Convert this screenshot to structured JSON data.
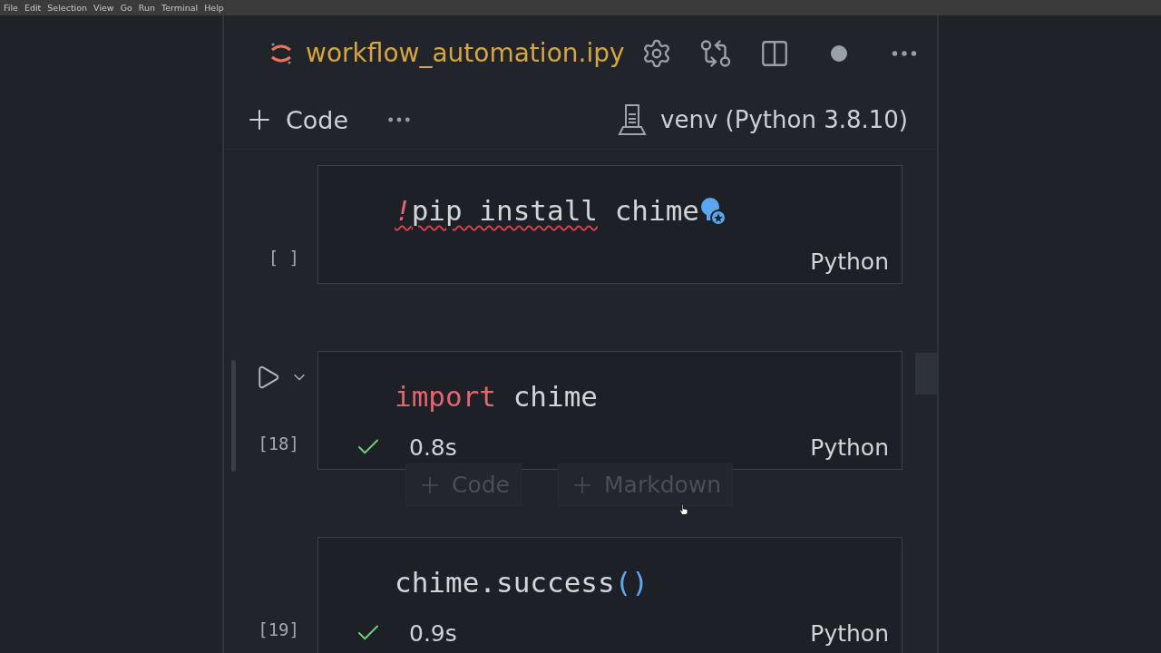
{
  "menu": [
    "File",
    "Edit",
    "Selection",
    "View",
    "Go",
    "Run",
    "Terminal",
    "Help"
  ],
  "editor": {
    "title": "workflow_automation.ipy",
    "dirty": true
  },
  "toolbar": {
    "add_label": "Code",
    "kernel": "venv (Python 3.8.10)"
  },
  "cells": [
    {
      "prompt": "[ ]",
      "focused": false,
      "succeeded": false,
      "language": "Python",
      "lightbulb": true,
      "tokens": [
        {
          "text": "!",
          "kind": "bang",
          "squiggle": true
        },
        {
          "text": "pip install",
          "kind": "plain",
          "squiggle": true
        },
        {
          "text": " chime",
          "kind": "plain",
          "squiggle": false
        }
      ]
    },
    {
      "prompt": "[18]",
      "focused": true,
      "succeeded": true,
      "time": "0.8s",
      "language": "Python",
      "lightbulb": false,
      "tokens": [
        {
          "text": "import",
          "kind": "keyword",
          "squiggle": false
        },
        {
          "text": " chime",
          "kind": "plain",
          "squiggle": false
        }
      ],
      "insert_buttons": [
        "Code",
        "Markdown"
      ]
    },
    {
      "prompt": "[19]",
      "focused": false,
      "succeeded": true,
      "time": "0.9s",
      "language": "Python",
      "lightbulb": false,
      "tokens": [
        {
          "text": "chime.success",
          "kind": "plain",
          "squiggle": false
        },
        {
          "text": "()",
          "kind": "paren",
          "squiggle": false
        }
      ]
    }
  ]
}
